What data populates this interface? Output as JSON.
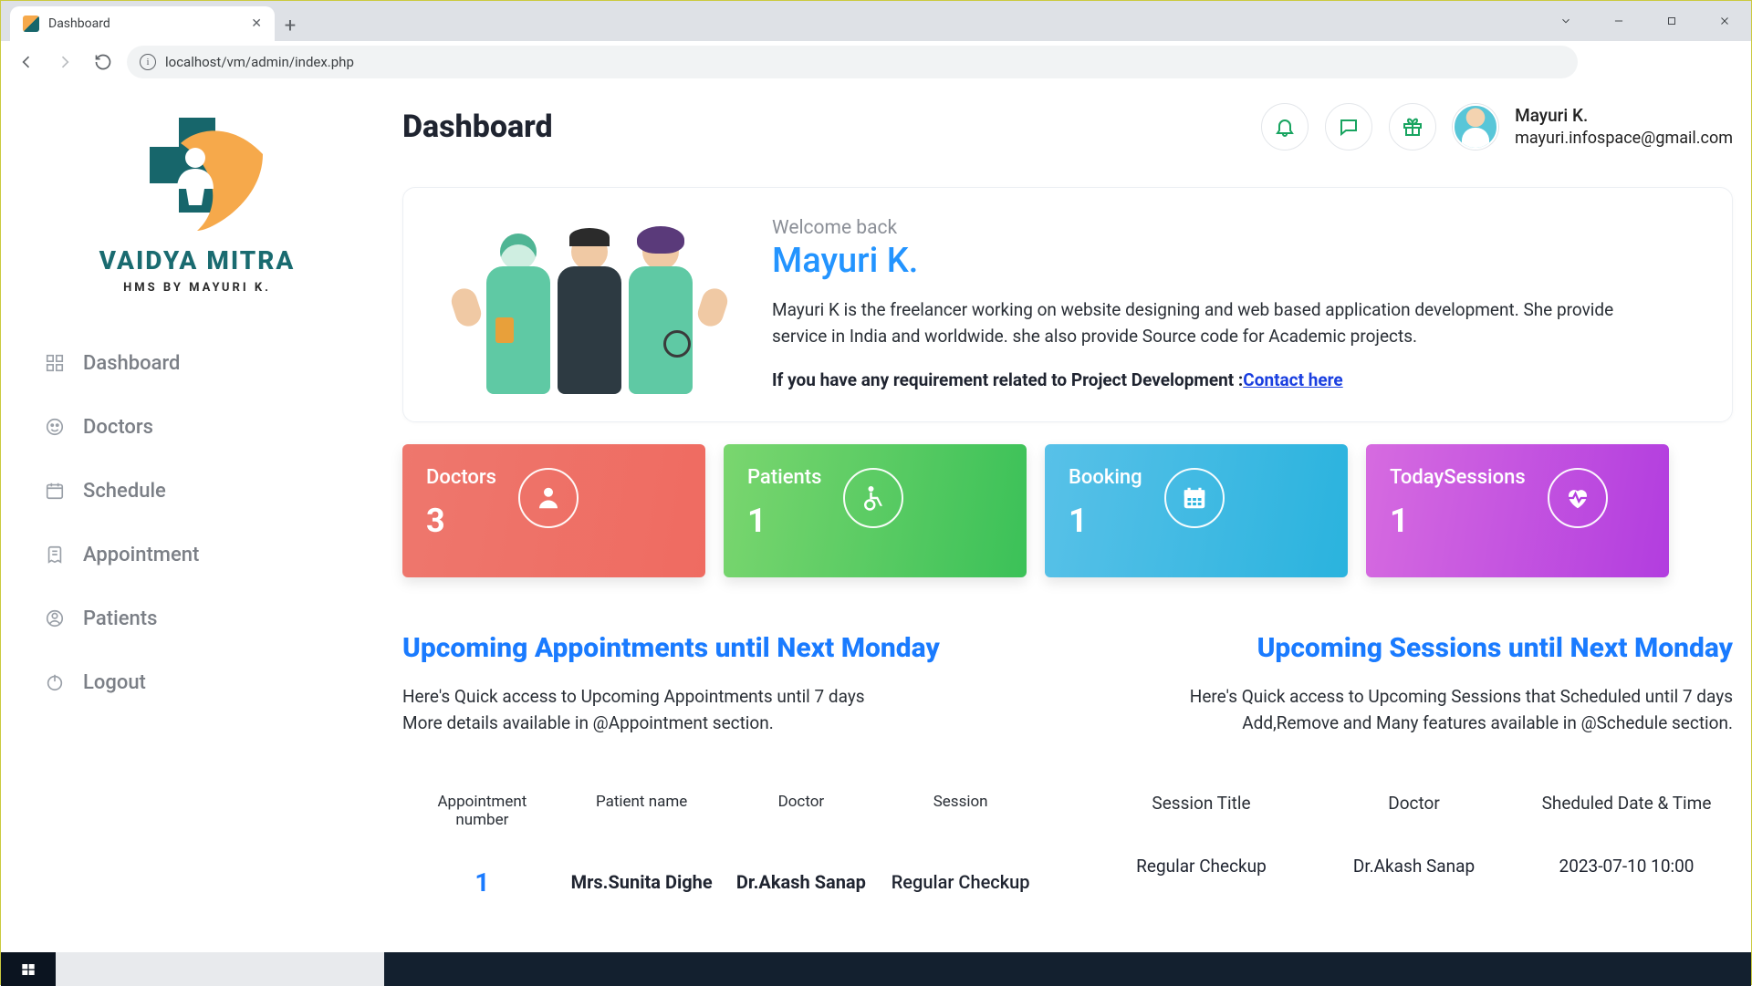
{
  "browser": {
    "tab_title": "Dashboard",
    "url": "localhost/vm/admin/index.php"
  },
  "brand": {
    "name": "VAIDYA MITRA",
    "sub": "HMS BY MAYURI K."
  },
  "sidebar": {
    "items": [
      {
        "label": "Dashboard",
        "icon": "dashboard"
      },
      {
        "label": "Doctors",
        "icon": "doctors"
      },
      {
        "label": "Schedule",
        "icon": "schedule"
      },
      {
        "label": "Appointment",
        "icon": "appointment"
      },
      {
        "label": "Patients",
        "icon": "patients"
      },
      {
        "label": "Logout",
        "icon": "logout"
      }
    ]
  },
  "header": {
    "title": "Dashboard",
    "user_name": "Mayuri K.",
    "user_email": "mayuri.infospace@gmail.com"
  },
  "welcome": {
    "back": "Welcome back",
    "name": "Mayuri K.",
    "desc": "Mayuri K is the freelancer working on website designing and web based application development. She provide service in India and worldwide. she also provide Source code for Academic projects.",
    "cta_prefix": "If you have any requirement related to Project Development :",
    "cta_link": "Contact here"
  },
  "stats": [
    {
      "label": "Doctors",
      "value": "3",
      "color": "red",
      "icon": "doctor"
    },
    {
      "label": "Patients",
      "value": "1",
      "color": "green",
      "icon": "wheelchair"
    },
    {
      "label": "Booking",
      "value": "1",
      "color": "blue",
      "icon": "calendar"
    },
    {
      "label": "TodaySessions",
      "value": "1",
      "color": "purple",
      "icon": "heart"
    }
  ],
  "appointments": {
    "title": "Upcoming Appointments until Next Monday",
    "sub1": "Here's Quick access to Upcoming Appointments until 7 days",
    "sub2": "More details available in @Appointment section.",
    "columns": [
      "Appointment number",
      "Patient name",
      "Doctor",
      "Session"
    ],
    "rows": [
      {
        "num": "1",
        "patient": "Mrs.Sunita Dighe",
        "doctor": "Dr.Akash Sanap",
        "session": "Regular Checkup"
      }
    ]
  },
  "sessions": {
    "title": "Upcoming Sessions until Next Monday",
    "sub1": "Here's Quick access to Upcoming Sessions that Scheduled until 7 days",
    "sub2": "Add,Remove and Many features available in @Schedule section.",
    "columns": [
      "Session Title",
      "Doctor",
      "Sheduled Date & Time"
    ],
    "rows": [
      {
        "title": "Regular Checkup",
        "doctor": "Dr.Akash Sanap",
        "datetime": "2023-07-10 10:00"
      }
    ]
  }
}
